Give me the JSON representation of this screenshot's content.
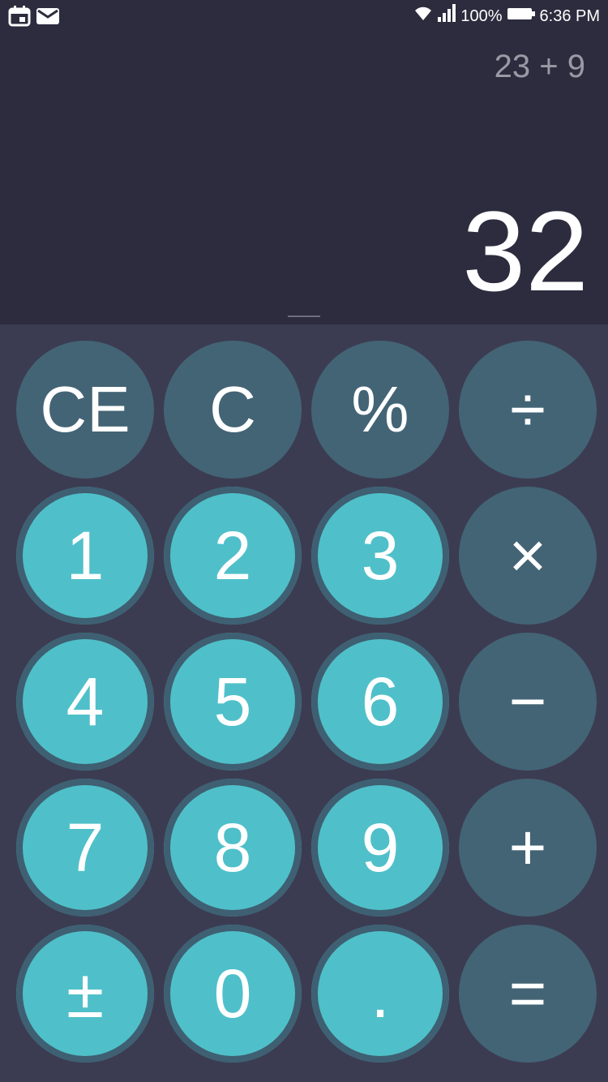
{
  "status_bar": {
    "battery_percent": "100%",
    "time": "6:36 PM",
    "icons": [
      "calendar-icon",
      "mail-icon",
      "wifi-icon",
      "signal-icon",
      "battery-icon"
    ]
  },
  "display": {
    "expression": "23 + 9",
    "result": "32"
  },
  "keys": {
    "ce": "CE",
    "c": "C",
    "percent": "%",
    "divide": "÷",
    "multiply": "×",
    "minus": "−",
    "plus": "+",
    "equals": "=",
    "d1": "1",
    "d2": "2",
    "d3": "3",
    "d4": "4",
    "d5": "5",
    "d6": "6",
    "d7": "7",
    "d8": "8",
    "d9": "9",
    "plus_minus": "±",
    "d0": "0",
    "decimal": "."
  },
  "colors": {
    "display_bg": "#2c2c3e",
    "keypad_bg": "#3b3c52",
    "number_key": "#4fc0c9",
    "operator_key": "#436475"
  }
}
